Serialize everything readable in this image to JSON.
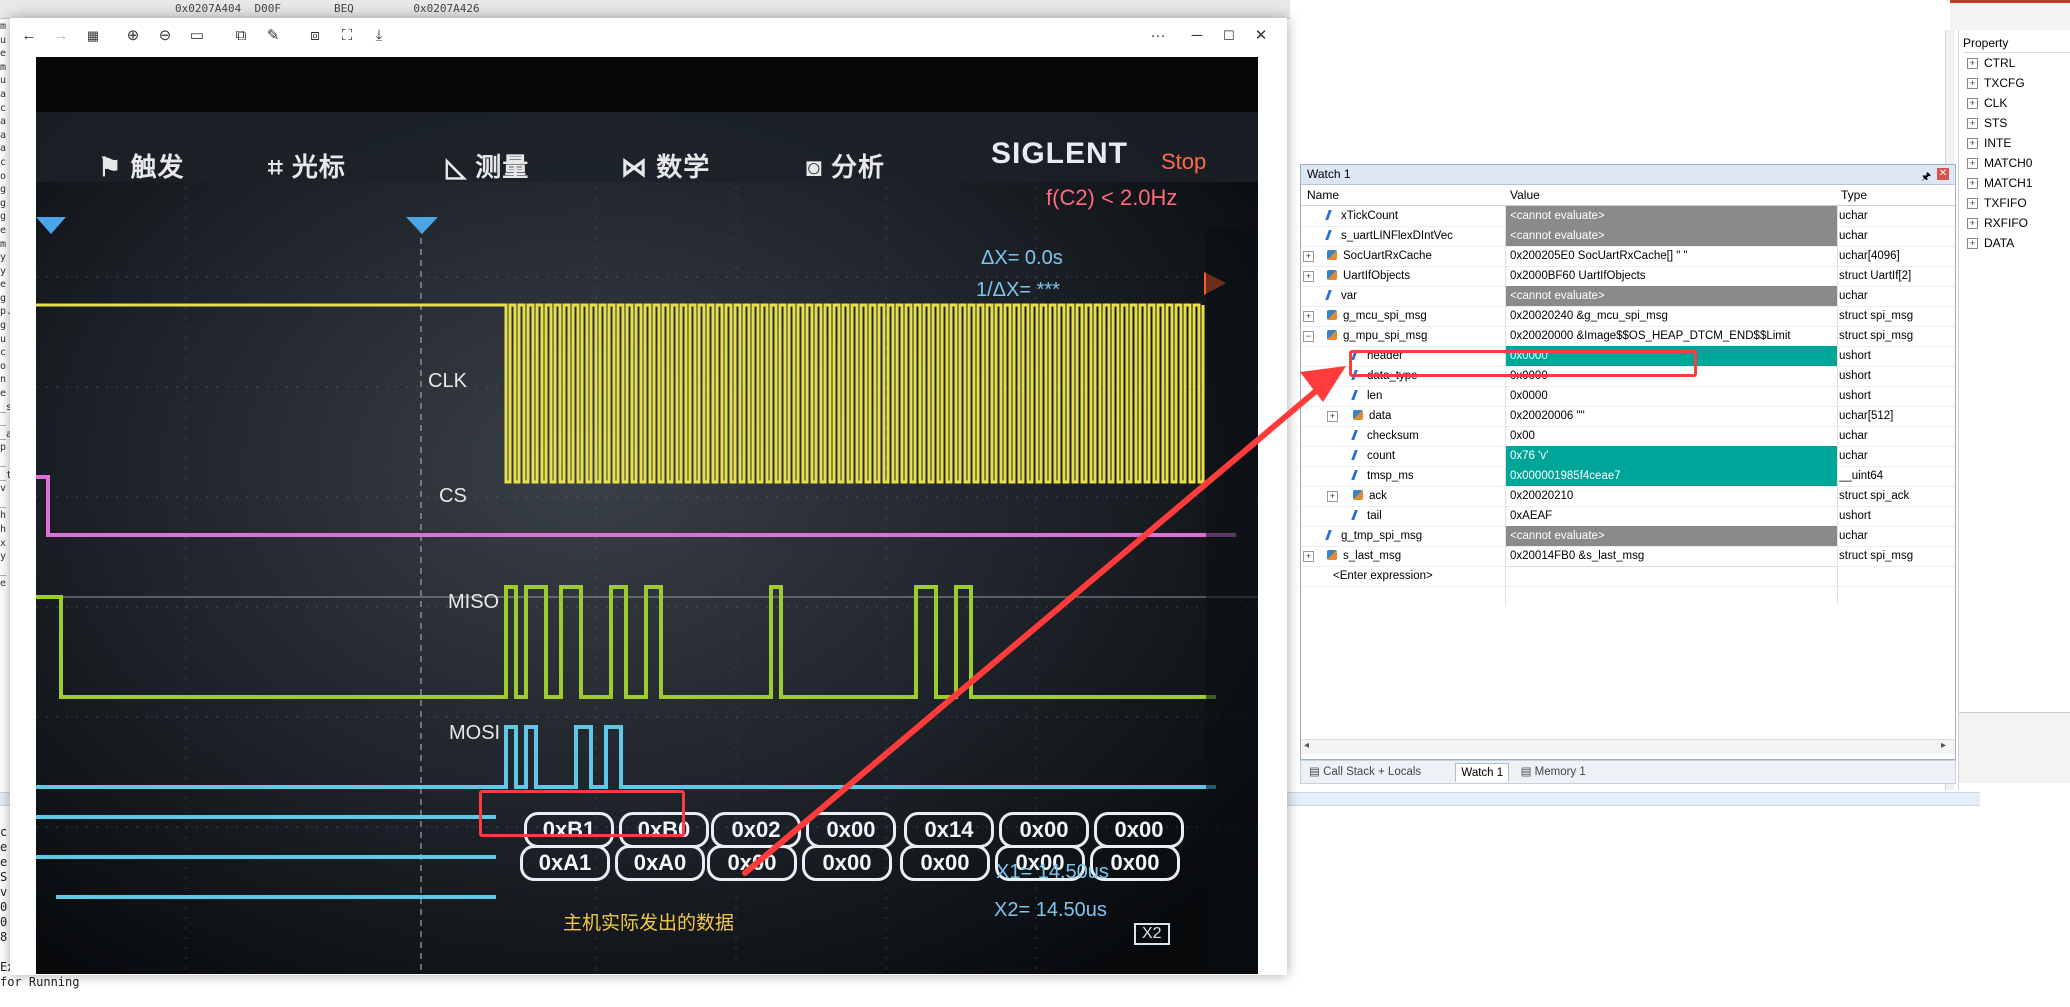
{
  "ide": {
    "top_address_line": "0x0207A404  D00F        BEQ         0x0207A426",
    "left_code_chars": [
      "m",
      "u",
      "e",
      "m",
      "u",
      "a",
      "c",
      "a",
      "a",
      "a",
      "c",
      "o",
      "g",
      "g",
      "g",
      "e",
      "m",
      "y",
      "y",
      "e",
      "g",
      "p.",
      "g",
      "u",
      "c",
      "o",
      "n",
      "e",
      "_s",
      "_",
      "_a",
      "p",
      "_",
      "_t",
      "v",
      "_",
      "h",
      "h",
      "x",
      "y",
      "_",
      "e"
    ],
    "bottom_code_lines": [
      "c",
      "e",
      "e",
      "S",
      "v",
      "0",
      "0",
      "8",
      "",
      "Exec (void) { // executes upon software RESET",
      "for Running"
    ]
  },
  "property_panel": {
    "title": "Property",
    "items": [
      "CTRL",
      "TXCFG",
      "CLK",
      "STS",
      "INTE",
      "MATCH0",
      "MATCH1",
      "TXFIFO",
      "RXFIFO",
      "DATA"
    ]
  },
  "watch": {
    "title": "Watch 1",
    "pin": "🖈",
    "close": "✕",
    "columns": {
      "name": "Name",
      "value": "Value",
      "type": "Type"
    },
    "rows": [
      {
        "name": "xTickCount",
        "value": "<cannot evaluate>",
        "type": "uchar",
        "level": 0,
        "style": "gray",
        "expand": "",
        "icon": "var"
      },
      {
        "name": "s_uartLINFlexDIntVec",
        "value": "<cannot evaluate>",
        "type": "uchar",
        "level": 0,
        "style": "gray",
        "expand": "",
        "icon": "var"
      },
      {
        "name": "SocUartRxCache",
        "value": "0x200205E0 SocUartRxCache[] \"   \"",
        "type": "uchar[4096]",
        "level": 0,
        "style": "",
        "expand": "+",
        "icon": "str"
      },
      {
        "name": "UartIfObjects",
        "value": "0x2000BF60 UartIfObjects",
        "type": "struct UartIf[2]",
        "level": 0,
        "style": "",
        "expand": "+",
        "icon": "str"
      },
      {
        "name": "var",
        "value": "<cannot evaluate>",
        "type": "uchar",
        "level": 0,
        "style": "gray",
        "expand": "",
        "icon": "var"
      },
      {
        "name": "g_mcu_spi_msg",
        "value": "0x20020240 &g_mcu_spi_msg",
        "type": "struct spi_msg",
        "level": 0,
        "style": "",
        "expand": "+",
        "icon": "str"
      },
      {
        "name": "g_mpu_spi_msg",
        "value": "0x20020000 &Image$$OS_HEAP_DTCM_END$$Limit",
        "type": "struct spi_msg",
        "level": 0,
        "style": "",
        "expand": "−",
        "icon": "str"
      },
      {
        "name": "header",
        "value": "0x0000",
        "type": "ushort",
        "level": 1,
        "style": "teal",
        "expand": "",
        "icon": "var"
      },
      {
        "name": "data_type",
        "value": "0x0000",
        "type": "ushort",
        "level": 1,
        "style": "",
        "expand": "",
        "icon": "var"
      },
      {
        "name": "len",
        "value": "0x0000",
        "type": "ushort",
        "level": 1,
        "style": "",
        "expand": "",
        "icon": "var"
      },
      {
        "name": "data",
        "value": "0x20020006 \"\"",
        "type": "uchar[512]",
        "level": 1,
        "style": "",
        "expand": "+",
        "icon": "str"
      },
      {
        "name": "checksum",
        "value": "0x00",
        "type": "uchar",
        "level": 1,
        "style": "",
        "expand": "",
        "icon": "var"
      },
      {
        "name": "count",
        "value": "0x76 'v'",
        "type": "uchar",
        "level": 1,
        "style": "teal",
        "expand": "",
        "icon": "var"
      },
      {
        "name": "tmsp_ms",
        "value": "0x000001985f4ceae7",
        "type": "__uint64",
        "level": 1,
        "style": "teal",
        "expand": "",
        "icon": "var"
      },
      {
        "name": "ack",
        "value": "0x20020210",
        "type": "struct spi_ack",
        "level": 1,
        "style": "",
        "expand": "+",
        "icon": "str"
      },
      {
        "name": "tail",
        "value": "0xAEAF",
        "type": "ushort",
        "level": 1,
        "style": "",
        "expand": "",
        "icon": "var"
      },
      {
        "name": "g_tmp_spi_msg",
        "value": "<cannot evaluate>",
        "type": "uchar",
        "level": 0,
        "style": "gray",
        "expand": "",
        "icon": "var"
      },
      {
        "name": "s_last_msg",
        "value": "0x20014FB0 &s_last_msg",
        "type": "struct spi_msg",
        "level": 0,
        "style": "",
        "expand": "+",
        "icon": "str"
      },
      {
        "name": "<Enter expression>",
        "value": "",
        "type": "",
        "level": -1,
        "style": "",
        "expand": "",
        "icon": ""
      }
    ],
    "tabs": [
      "Call Stack + Locals",
      "Watch 1",
      "Memory 1"
    ],
    "active_tab": 1
  },
  "viewer": {
    "toolbar_icons": [
      "back-icon",
      "forward-icon",
      "grid-icon",
      "zoom-in-icon",
      "zoom-out-icon",
      "fit-icon",
      "crop-icon",
      "edit-icon",
      "compare-icon",
      "fullscreen-icon",
      "save-icon"
    ],
    "more": "···",
    "minimize": "─",
    "maximize": "☐",
    "close": "✕"
  },
  "scope": {
    "menus": [
      "触发",
      "光标",
      "测量",
      "数学",
      "分析"
    ],
    "brand": "SIGLENT",
    "status": "Stop",
    "freq": "f(C2) < 2.0Hz",
    "delta": "ΔX= 0.0s",
    "inv_delta": "1/ΔX= ***",
    "channels": [
      "CLK",
      "CS",
      "MISO",
      "MOSI"
    ],
    "decode_top": [
      "0xB1",
      "0xB0",
      "0x02",
      "0x00",
      "0x14",
      "0x00",
      "0x00"
    ],
    "decode_bottom": [
      "0xA1",
      "0xA0",
      "0x00",
      "0x00",
      "0x00",
      "0x00",
      "0x00"
    ],
    "x1": "X1= 14.50us",
    "x2": "X2= 14.50us",
    "x2_box": "X2",
    "annotation": "主机实际发出的数据"
  },
  "colors": {
    "clk": "#e8e04a",
    "cs": "#e070d8",
    "miso": "#9ccc2e",
    "mosi": "#5ec8e6",
    "highlight_teal": "#00a59a",
    "annotation_red": "#ff3b3b"
  }
}
